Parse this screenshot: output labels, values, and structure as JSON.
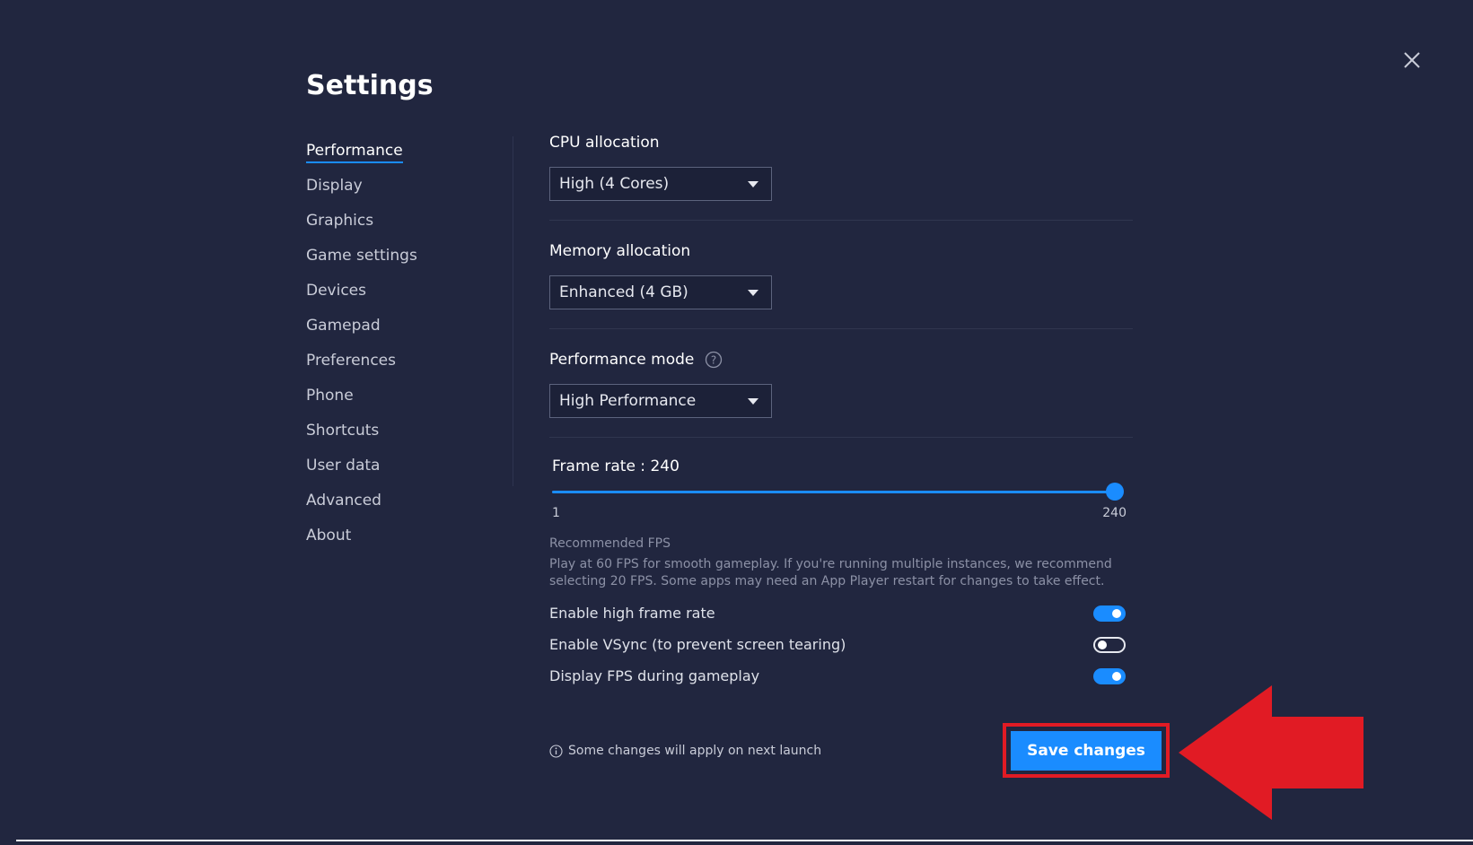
{
  "window": {
    "title": "Settings",
    "close_icon": "close-icon"
  },
  "sidebar": {
    "items": [
      {
        "label": "Performance",
        "active": true
      },
      {
        "label": "Display",
        "active": false
      },
      {
        "label": "Graphics",
        "active": false
      },
      {
        "label": "Game settings",
        "active": false
      },
      {
        "label": "Devices",
        "active": false
      },
      {
        "label": "Gamepad",
        "active": false
      },
      {
        "label": "Preferences",
        "active": false
      },
      {
        "label": "Phone",
        "active": false
      },
      {
        "label": "Shortcuts",
        "active": false
      },
      {
        "label": "User data",
        "active": false
      },
      {
        "label": "Advanced",
        "active": false
      },
      {
        "label": "About",
        "active": false
      }
    ]
  },
  "main": {
    "cpu": {
      "label": "CPU allocation",
      "value": "High (4 Cores)"
    },
    "memory": {
      "label": "Memory allocation",
      "value": "Enhanced (4 GB)"
    },
    "performance_mode": {
      "label": "Performance mode",
      "value": "High Performance",
      "help_icon": "help-icon"
    },
    "frame_rate": {
      "label": "Frame rate : 240",
      "value": 240,
      "min": 1,
      "max": 240,
      "min_label": "1",
      "max_label": "240"
    },
    "recommended": {
      "title": "Recommended FPS",
      "text": "Play at 60 FPS for smooth gameplay. If you're running multiple instances, we recommend selecting 20 FPS. Some apps may need an App Player restart for changes to take effect."
    },
    "toggles": [
      {
        "label": "Enable high frame rate",
        "on": true
      },
      {
        "label": "Enable VSync (to prevent screen tearing)",
        "on": false
      },
      {
        "label": "Display FPS during gameplay",
        "on": true
      }
    ]
  },
  "footer": {
    "note": "Some changes will apply on next launch",
    "save_label": "Save changes"
  },
  "colors": {
    "background": "#21263f",
    "accent": "#1a8cff",
    "highlight": "#e11b24"
  }
}
